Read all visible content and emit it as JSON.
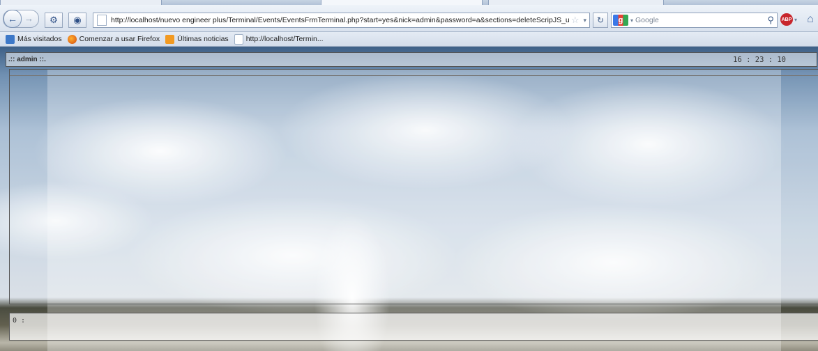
{
  "browser": {
    "url": "http://localhost/nuevo engineer plus/Terminal/Events/EventsFrmTerminal.php?start=yes&nick=admin&password=a&sections=deleteScripJS_unRegiste",
    "search_placeholder": "Google",
    "search_engine_letter": "g",
    "abp_label": "ABP",
    "icons": {
      "back": "back-arrow-icon",
      "forward": "forward-arrow-icon",
      "reload": "reload-icon",
      "home": "home-icon",
      "star": "bookmark-star-icon",
      "search": "magnifier-icon"
    }
  },
  "bookmarks": [
    {
      "label": "Más visitados",
      "icon": "most-visited-icon"
    },
    {
      "label": "Comenzar a usar Firefox",
      "icon": "firefox-icon"
    },
    {
      "label": "Últimas noticias",
      "icon": "rss-icon"
    },
    {
      "label": "http://localhost/Termin...",
      "icon": "page-icon"
    }
  ],
  "terminal": {
    "user_label": ".:: admin ::.",
    "clock": "16 : 23 : 10",
    "prompt": "0 :"
  }
}
